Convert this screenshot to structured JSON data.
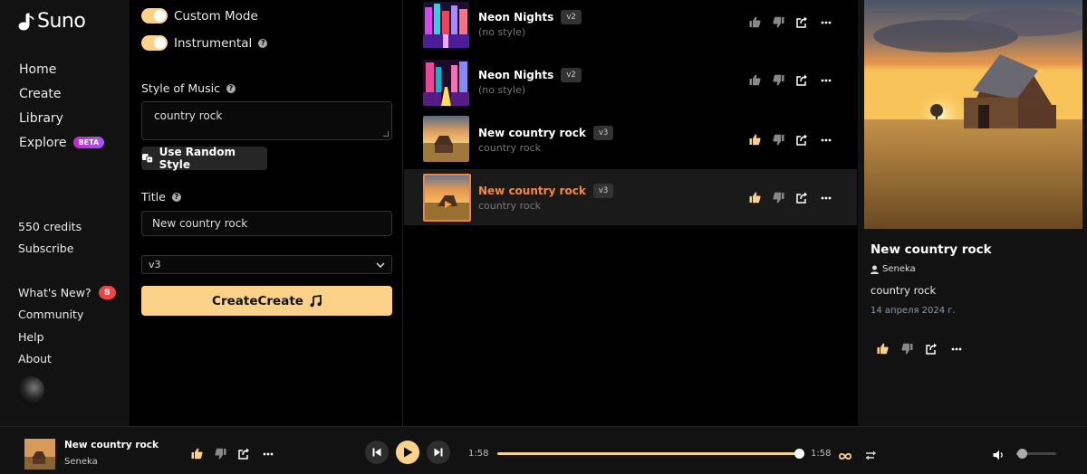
{
  "app": {
    "name": "Suno"
  },
  "nav": {
    "items": [
      {
        "label": "Home"
      },
      {
        "label": "Create"
      },
      {
        "label": "Library"
      },
      {
        "label": "Explore",
        "badge": "BETA"
      }
    ]
  },
  "account": {
    "credits": "550 credits",
    "subscribe": "Subscribe"
  },
  "links": {
    "whats_new": "What's New?",
    "whats_new_count": "8",
    "community": "Community",
    "help": "Help",
    "about": "About"
  },
  "form": {
    "custom_mode": "Custom Mode",
    "instrumental": "Instrumental",
    "style_label": "Style of Music",
    "style_value": "country rock",
    "random_style": "Use Random Style",
    "title_label": "Title",
    "title_value": "New country rock",
    "version": "v3",
    "create_label": "CreateCreate"
  },
  "songs": [
    {
      "title": "Neon Nights",
      "version": "v2",
      "subtitle": "(no style)",
      "liked": false,
      "active": false
    },
    {
      "title": "Neon Nights",
      "version": "v2",
      "subtitle": "(no style)",
      "liked": false,
      "active": false
    },
    {
      "title": "New country rock",
      "version": "v3",
      "subtitle": "country rock",
      "liked": true,
      "active": false
    },
    {
      "title": "New country rock",
      "version": "v3",
      "subtitle": "country rock",
      "liked": true,
      "active": true
    }
  ],
  "detail": {
    "title": "New country rock",
    "author": "Seneka",
    "style": "country rock",
    "date": "14 апреля 2024 г."
  },
  "player": {
    "title": "New country rock",
    "author": "Seneka",
    "elapsed": "1:58",
    "duration": "1:58",
    "progress": 1.0,
    "volume": 0.05
  },
  "colors": {
    "accent": "#fcd289",
    "active_title": "#f08a44",
    "badge": "#ef4444"
  }
}
